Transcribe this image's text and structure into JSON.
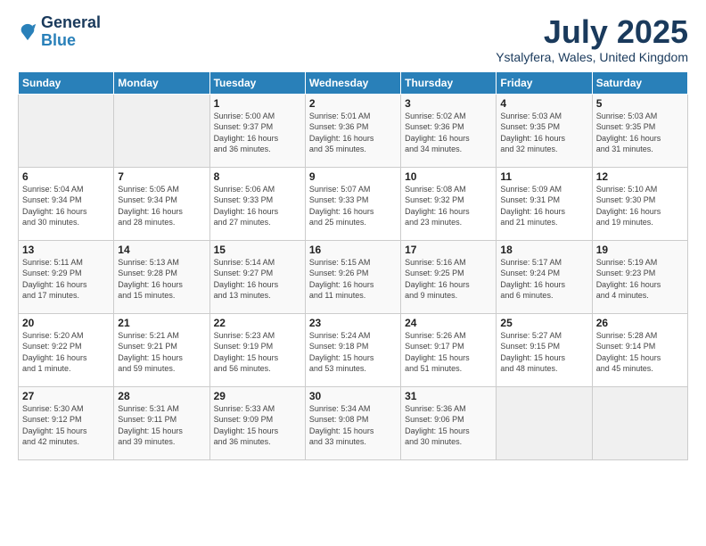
{
  "logo": {
    "general": "General",
    "blue": "Blue"
  },
  "title": "July 2025",
  "location": "Ystalyfera, Wales, United Kingdom",
  "weekdays": [
    "Sunday",
    "Monday",
    "Tuesday",
    "Wednesday",
    "Thursday",
    "Friday",
    "Saturday"
  ],
  "weeks": [
    [
      {
        "day": "",
        "info": ""
      },
      {
        "day": "",
        "info": ""
      },
      {
        "day": "1",
        "info": "Sunrise: 5:00 AM\nSunset: 9:37 PM\nDaylight: 16 hours\nand 36 minutes."
      },
      {
        "day": "2",
        "info": "Sunrise: 5:01 AM\nSunset: 9:36 PM\nDaylight: 16 hours\nand 35 minutes."
      },
      {
        "day": "3",
        "info": "Sunrise: 5:02 AM\nSunset: 9:36 PM\nDaylight: 16 hours\nand 34 minutes."
      },
      {
        "day": "4",
        "info": "Sunrise: 5:03 AM\nSunset: 9:35 PM\nDaylight: 16 hours\nand 32 minutes."
      },
      {
        "day": "5",
        "info": "Sunrise: 5:03 AM\nSunset: 9:35 PM\nDaylight: 16 hours\nand 31 minutes."
      }
    ],
    [
      {
        "day": "6",
        "info": "Sunrise: 5:04 AM\nSunset: 9:34 PM\nDaylight: 16 hours\nand 30 minutes."
      },
      {
        "day": "7",
        "info": "Sunrise: 5:05 AM\nSunset: 9:34 PM\nDaylight: 16 hours\nand 28 minutes."
      },
      {
        "day": "8",
        "info": "Sunrise: 5:06 AM\nSunset: 9:33 PM\nDaylight: 16 hours\nand 27 minutes."
      },
      {
        "day": "9",
        "info": "Sunrise: 5:07 AM\nSunset: 9:33 PM\nDaylight: 16 hours\nand 25 minutes."
      },
      {
        "day": "10",
        "info": "Sunrise: 5:08 AM\nSunset: 9:32 PM\nDaylight: 16 hours\nand 23 minutes."
      },
      {
        "day": "11",
        "info": "Sunrise: 5:09 AM\nSunset: 9:31 PM\nDaylight: 16 hours\nand 21 minutes."
      },
      {
        "day": "12",
        "info": "Sunrise: 5:10 AM\nSunset: 9:30 PM\nDaylight: 16 hours\nand 19 minutes."
      }
    ],
    [
      {
        "day": "13",
        "info": "Sunrise: 5:11 AM\nSunset: 9:29 PM\nDaylight: 16 hours\nand 17 minutes."
      },
      {
        "day": "14",
        "info": "Sunrise: 5:13 AM\nSunset: 9:28 PM\nDaylight: 16 hours\nand 15 minutes."
      },
      {
        "day": "15",
        "info": "Sunrise: 5:14 AM\nSunset: 9:27 PM\nDaylight: 16 hours\nand 13 minutes."
      },
      {
        "day": "16",
        "info": "Sunrise: 5:15 AM\nSunset: 9:26 PM\nDaylight: 16 hours\nand 11 minutes."
      },
      {
        "day": "17",
        "info": "Sunrise: 5:16 AM\nSunset: 9:25 PM\nDaylight: 16 hours\nand 9 minutes."
      },
      {
        "day": "18",
        "info": "Sunrise: 5:17 AM\nSunset: 9:24 PM\nDaylight: 16 hours\nand 6 minutes."
      },
      {
        "day": "19",
        "info": "Sunrise: 5:19 AM\nSunset: 9:23 PM\nDaylight: 16 hours\nand 4 minutes."
      }
    ],
    [
      {
        "day": "20",
        "info": "Sunrise: 5:20 AM\nSunset: 9:22 PM\nDaylight: 16 hours\nand 1 minute."
      },
      {
        "day": "21",
        "info": "Sunrise: 5:21 AM\nSunset: 9:21 PM\nDaylight: 15 hours\nand 59 minutes."
      },
      {
        "day": "22",
        "info": "Sunrise: 5:23 AM\nSunset: 9:19 PM\nDaylight: 15 hours\nand 56 minutes."
      },
      {
        "day": "23",
        "info": "Sunrise: 5:24 AM\nSunset: 9:18 PM\nDaylight: 15 hours\nand 53 minutes."
      },
      {
        "day": "24",
        "info": "Sunrise: 5:26 AM\nSunset: 9:17 PM\nDaylight: 15 hours\nand 51 minutes."
      },
      {
        "day": "25",
        "info": "Sunrise: 5:27 AM\nSunset: 9:15 PM\nDaylight: 15 hours\nand 48 minutes."
      },
      {
        "day": "26",
        "info": "Sunrise: 5:28 AM\nSunset: 9:14 PM\nDaylight: 15 hours\nand 45 minutes."
      }
    ],
    [
      {
        "day": "27",
        "info": "Sunrise: 5:30 AM\nSunset: 9:12 PM\nDaylight: 15 hours\nand 42 minutes."
      },
      {
        "day": "28",
        "info": "Sunrise: 5:31 AM\nSunset: 9:11 PM\nDaylight: 15 hours\nand 39 minutes."
      },
      {
        "day": "29",
        "info": "Sunrise: 5:33 AM\nSunset: 9:09 PM\nDaylight: 15 hours\nand 36 minutes."
      },
      {
        "day": "30",
        "info": "Sunrise: 5:34 AM\nSunset: 9:08 PM\nDaylight: 15 hours\nand 33 minutes."
      },
      {
        "day": "31",
        "info": "Sunrise: 5:36 AM\nSunset: 9:06 PM\nDaylight: 15 hours\nand 30 minutes."
      },
      {
        "day": "",
        "info": ""
      },
      {
        "day": "",
        "info": ""
      }
    ]
  ]
}
